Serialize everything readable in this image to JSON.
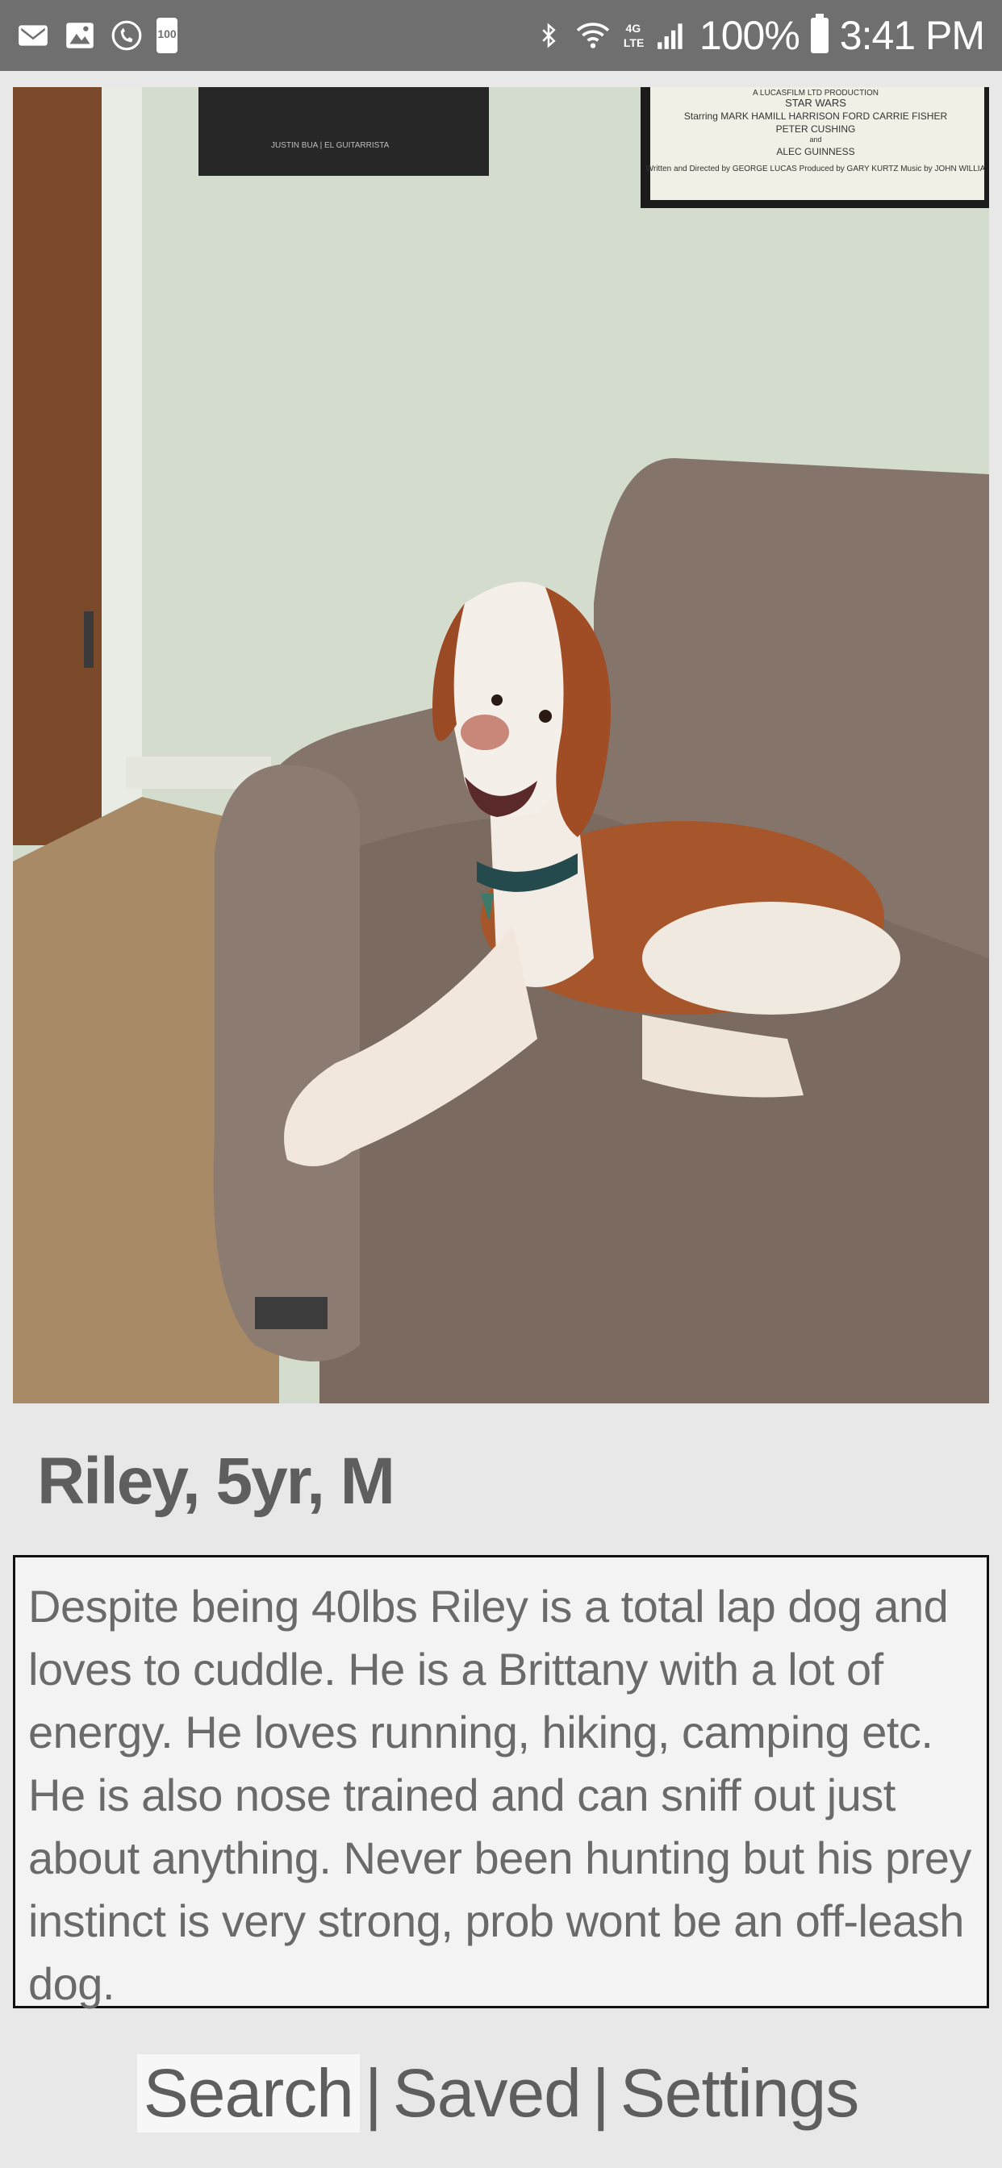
{
  "status_bar": {
    "left_icons": [
      "mail-icon",
      "image-icon",
      "call-icon",
      "battery-saver-icon"
    ],
    "battery_saver_text": "100",
    "right_icons": [
      "bluetooth-icon",
      "wifi-icon",
      "lte-icon",
      "signal-icon",
      "battery-icon"
    ],
    "lte_text": "4G LTE",
    "battery_percent": "100%",
    "time": "3:41 PM"
  },
  "profile": {
    "photo_alt": "dog-photo",
    "poster_left_caption": "JUSTIN BUA | EL GUITARRISTA",
    "poster_right_lines": [
      "A LUCASFILM LTD PRODUCTION",
      "STAR WARS",
      "Starring MARK HAMILL HARRISON FORD CARRIE FISHER",
      "PETER CUSHING",
      "and",
      "ALEC GUINNESS",
      "Written and Directed by GEORGE LUCAS Produced by GARY KURTZ Music by JOHN WILLIA"
    ],
    "name_line": "Riley, 5yr, M",
    "description": "Despite being 40lbs Riley is a total lap dog and loves to cuddle. He is a Brittany with a lot of energy. He loves running, hiking, camping etc. He is also nose trained and can sniff out just about anything. Never been hunting but his prey instinct is very strong, prob wont be an off-leash dog."
  },
  "nav": {
    "search": "Search",
    "saved": "Saved",
    "settings": "Settings",
    "separator": "|",
    "active": "search"
  },
  "colors": {
    "status_bar": "#6f6f6f",
    "background": "#e8e8e8",
    "text": "#5e5e5e"
  }
}
